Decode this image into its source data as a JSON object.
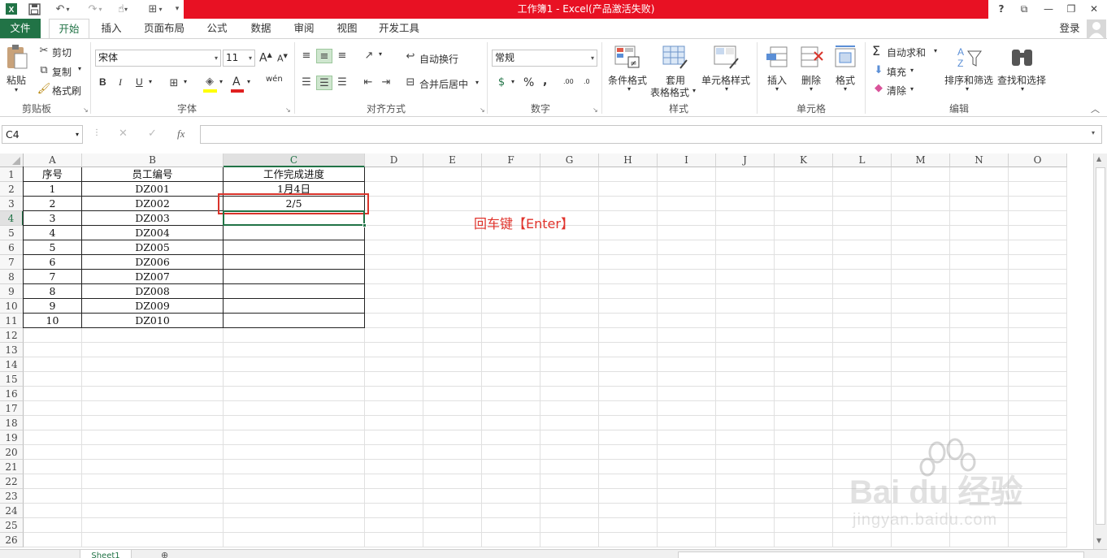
{
  "window": {
    "title": "工作簿1 -  Excel(产品激活失败)",
    "help_label": "?",
    "restore_ribbon_label": "⧉",
    "minimize_label": "—",
    "maximize_label": "❐",
    "close_label": "✕"
  },
  "quick_access": {
    "excel_icon": "X",
    "save_icon": "save-icon",
    "undo_icon": "undo-icon",
    "redo_icon": "redo-icon"
  },
  "tabs": [
    {
      "label": "文件"
    },
    {
      "label": "开始"
    },
    {
      "label": "插入"
    },
    {
      "label": "页面布局"
    },
    {
      "label": "公式"
    },
    {
      "label": "数据"
    },
    {
      "label": "审阅"
    },
    {
      "label": "视图"
    },
    {
      "label": "开发工具"
    }
  ],
  "account": {
    "login_label": "登录"
  },
  "ribbon": {
    "clipboard": {
      "paste": "粘贴",
      "cut": "剪切",
      "copy": "复制",
      "format_painter": "格式刷",
      "group": "剪贴板"
    },
    "font": {
      "name": "宋体",
      "size": "11",
      "bold": "B",
      "italic": "I",
      "underline": "U",
      "group": "字体",
      "grow": "A",
      "shrink": "A",
      "phonetic": "wén"
    },
    "alignment": {
      "wrap": "自动换行",
      "merge": "合并后居中",
      "group": "对齐方式"
    },
    "number": {
      "format": "常规",
      "percent": "%",
      "comma": ",",
      "inc_decimal": ".00",
      "dec_decimal": ".0",
      "group": "数字"
    },
    "styles": {
      "conditional": "条件格式",
      "table_l1": "套用",
      "table_l2": "表格格式",
      "cell_styles": "单元格样式",
      "group": "样式"
    },
    "cells": {
      "insert": "插入",
      "delete": "删除",
      "format": "格式",
      "group": "单元格"
    },
    "editing": {
      "autosum": "自动求和",
      "fill": "填充",
      "clear": "清除",
      "sort": "排序和筛选",
      "find": "查找和选择",
      "group": "编辑"
    }
  },
  "formula_bar": {
    "name_box": "C4",
    "cancel": "✕",
    "enter": "✓",
    "fx": "fx",
    "value": ""
  },
  "columns": [
    "A",
    "B",
    "C",
    "D",
    "E",
    "F",
    "G",
    "H",
    "I",
    "J",
    "K",
    "L",
    "M",
    "N",
    "O"
  ],
  "rows": [
    "1",
    "2",
    "3",
    "4",
    "5",
    "6",
    "7",
    "8",
    "9",
    "10",
    "11",
    "12",
    "13",
    "14",
    "15",
    "16",
    "17",
    "18",
    "19",
    "20",
    "21",
    "22",
    "23",
    "24",
    "25",
    "26"
  ],
  "table": {
    "headers": [
      "序号",
      "员工编号",
      "工作完成进度"
    ],
    "rows": [
      [
        "1",
        "DZ001",
        "1月4日"
      ],
      [
        "2",
        "DZ002",
        "2/5"
      ],
      [
        "3",
        "DZ003",
        ""
      ],
      [
        "4",
        "DZ004",
        ""
      ],
      [
        "5",
        "DZ005",
        ""
      ],
      [
        "6",
        "DZ006",
        ""
      ],
      [
        "7",
        "DZ007",
        ""
      ],
      [
        "8",
        "DZ008",
        ""
      ],
      [
        "9",
        "DZ009",
        ""
      ],
      [
        "10",
        "DZ010",
        ""
      ]
    ]
  },
  "annotation": {
    "text": "回车键【Enter】",
    "color": "#e0332c"
  },
  "watermark": {
    "brand": "Bai  du 经验",
    "url": "jingyan.baidu.com"
  },
  "sheet_tab": {
    "label": "Sheet1"
  },
  "colors": {
    "excel_green": "#217346",
    "title_red": "#e81123",
    "highlight_red": "#d9342b"
  }
}
